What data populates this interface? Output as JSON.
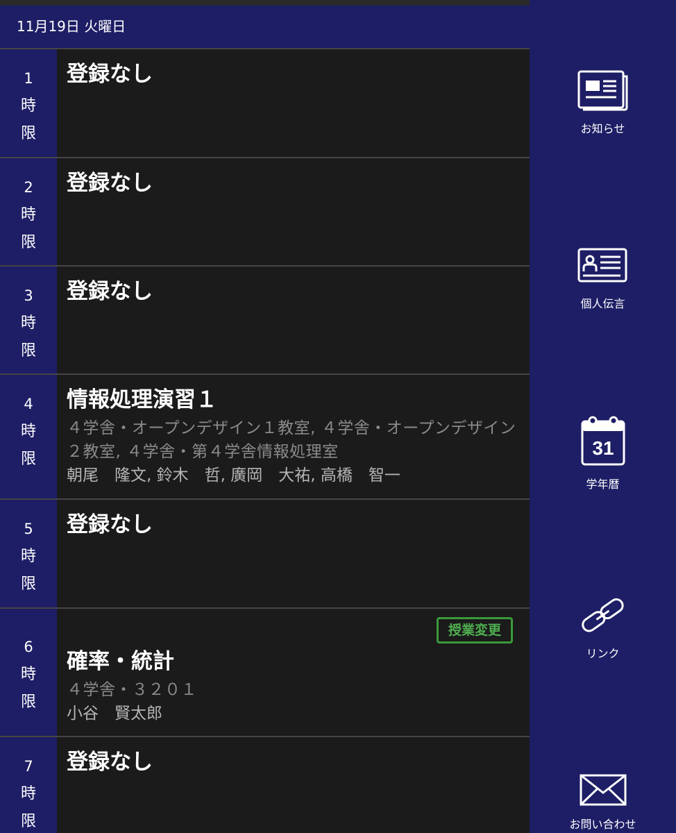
{
  "date_header": "11月19日 火曜日",
  "period_suffix": [
    "時",
    "限"
  ],
  "periods": [
    {
      "num": "1",
      "title": "登録なし"
    },
    {
      "num": "2",
      "title": "登録なし"
    },
    {
      "num": "3",
      "title": "登録なし"
    },
    {
      "num": "4",
      "title": "情報処理演習１",
      "room": "４学舎・オープンデザイン１教室, ４学舎・オープンデザイン２教室, ４学舎・第４学舎情報処理室",
      "teacher": "朝尾　隆文, 鈴木　哲, 廣岡　大祐, 高橋　智一"
    },
    {
      "num": "5",
      "title": "登録なし"
    },
    {
      "num": "6",
      "title": "確率・統計",
      "room": "４学舎・３２０１",
      "teacher": "小谷　賢太郎",
      "badge": "授業変更"
    },
    {
      "num": "7",
      "title": "登録なし"
    }
  ],
  "sidebar": {
    "items": [
      {
        "label": "お知らせ",
        "icon": "newspaper-icon"
      },
      {
        "label": "個人伝言",
        "icon": "id-card-icon"
      },
      {
        "label": "学年暦",
        "icon": "calendar-icon",
        "calendar_day": "31"
      },
      {
        "label": "リンク",
        "icon": "link-icon"
      },
      {
        "label": "お問い合わせ",
        "icon": "envelope-icon"
      }
    ]
  },
  "colors": {
    "navy": "#1e1e66",
    "cell_bg": "#1b1b1b",
    "badge_green": "#3a9a3a"
  }
}
